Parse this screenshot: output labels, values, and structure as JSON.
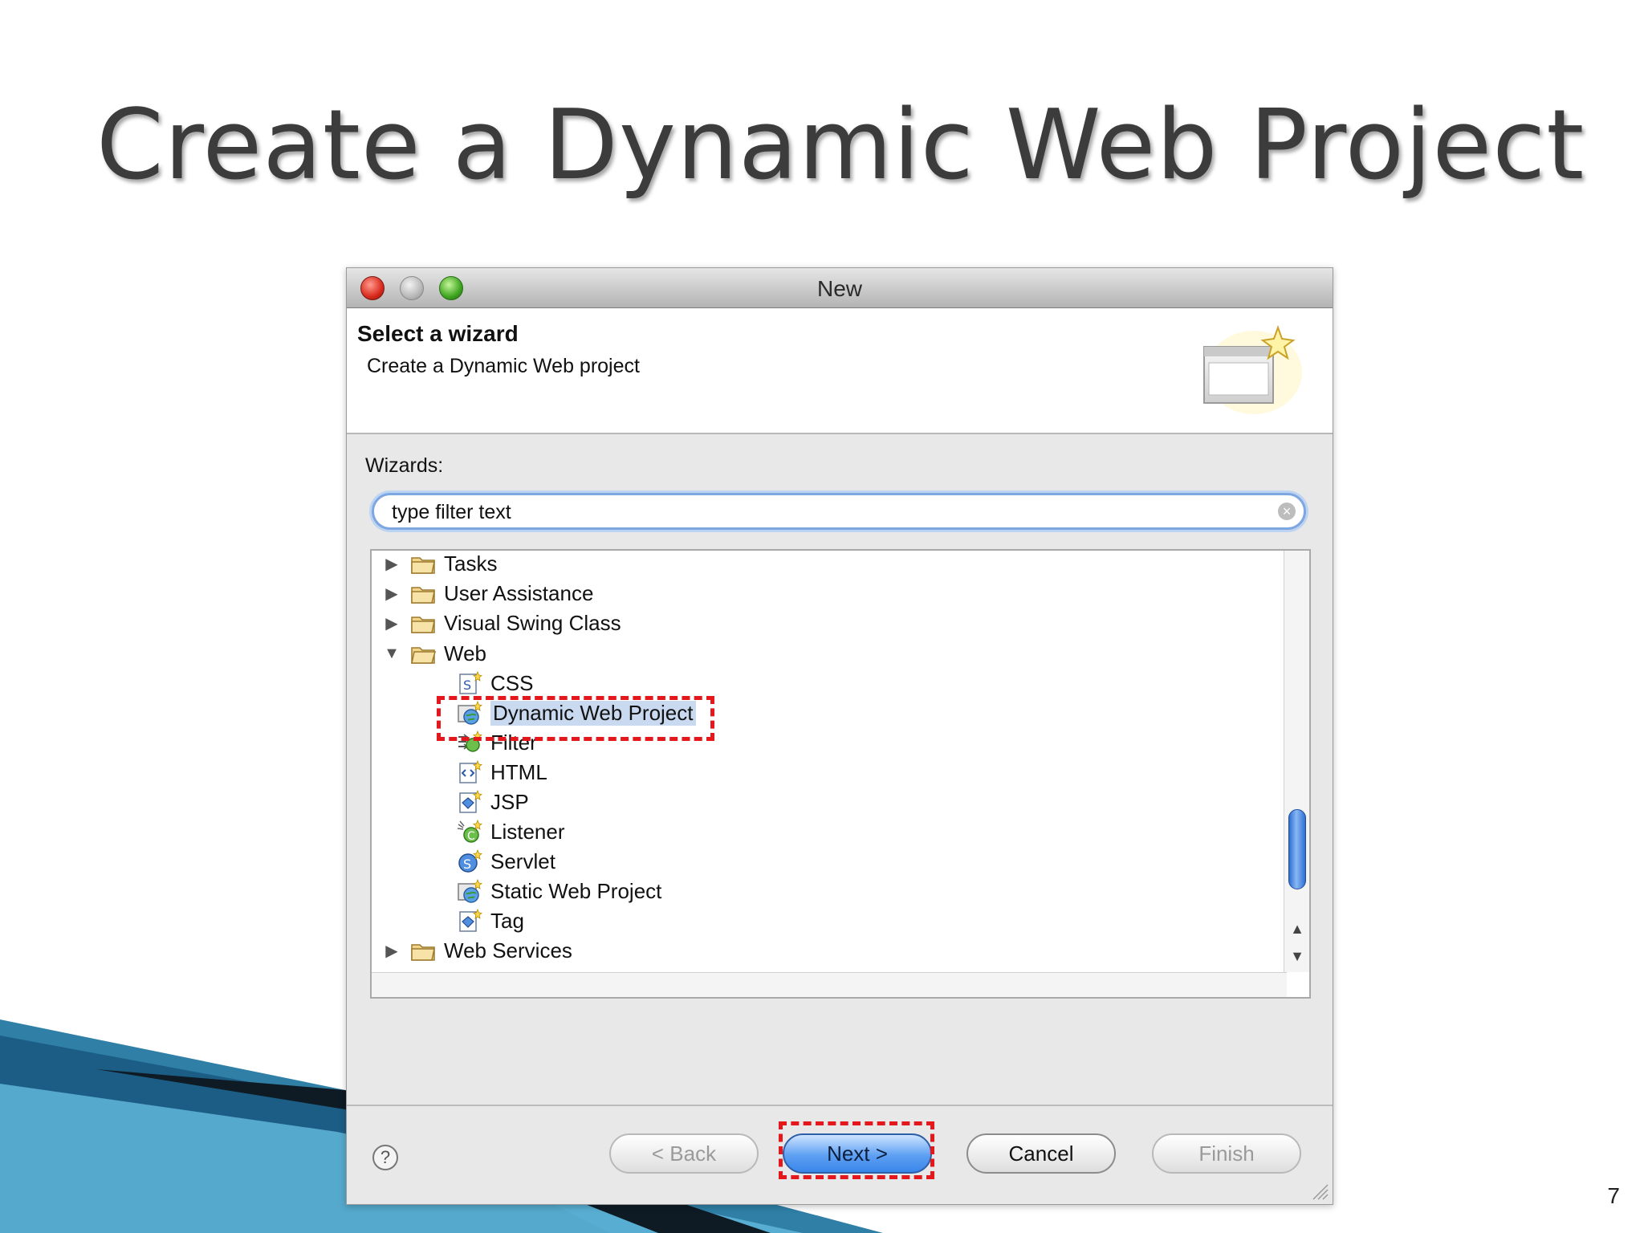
{
  "slide": {
    "title": "Create a Dynamic Web Project",
    "number": "7"
  },
  "dialog": {
    "window_title": "New",
    "header_title": "Select a wizard",
    "header_description": "Create a Dynamic Web project",
    "wizards_label": "Wizards:",
    "filter": {
      "value": "type filter text",
      "placeholder": "type filter text"
    },
    "tree": [
      {
        "label": "Tasks",
        "type": "folder",
        "expanded": false,
        "icon": "folder-icon"
      },
      {
        "label": "User Assistance",
        "type": "folder",
        "expanded": false,
        "icon": "folder-icon"
      },
      {
        "label": "Visual Swing Class",
        "type": "folder",
        "expanded": false,
        "icon": "folder-icon"
      },
      {
        "label": "Web",
        "type": "folder",
        "expanded": true,
        "icon": "folder-icon"
      },
      {
        "label": "CSS",
        "type": "item",
        "icon": "css-file-icon"
      },
      {
        "label": "Dynamic Web Project",
        "type": "item",
        "selected": true,
        "icon": "web-project-icon"
      },
      {
        "label": "Filter",
        "type": "item",
        "icon": "filter-icon"
      },
      {
        "label": "HTML",
        "type": "item",
        "icon": "html-file-icon"
      },
      {
        "label": "JSP",
        "type": "item",
        "icon": "jsp-file-icon"
      },
      {
        "label": "Listener",
        "type": "item",
        "icon": "listener-icon"
      },
      {
        "label": "Servlet",
        "type": "item",
        "icon": "servlet-icon"
      },
      {
        "label": "Static Web Project",
        "type": "item",
        "icon": "web-project-icon"
      },
      {
        "label": "Tag",
        "type": "item",
        "icon": "tag-file-icon"
      },
      {
        "label": "Web Services",
        "type": "folder",
        "expanded": false,
        "icon": "folder-icon"
      }
    ],
    "buttons": {
      "back": "< Back",
      "next": "Next >",
      "cancel": "Cancel",
      "finish": "Finish"
    },
    "help_symbol": "?"
  },
  "colors": {
    "highlight": "#e4171d",
    "primary_button": "#3a86ea",
    "selection": "#c8d9f0"
  }
}
